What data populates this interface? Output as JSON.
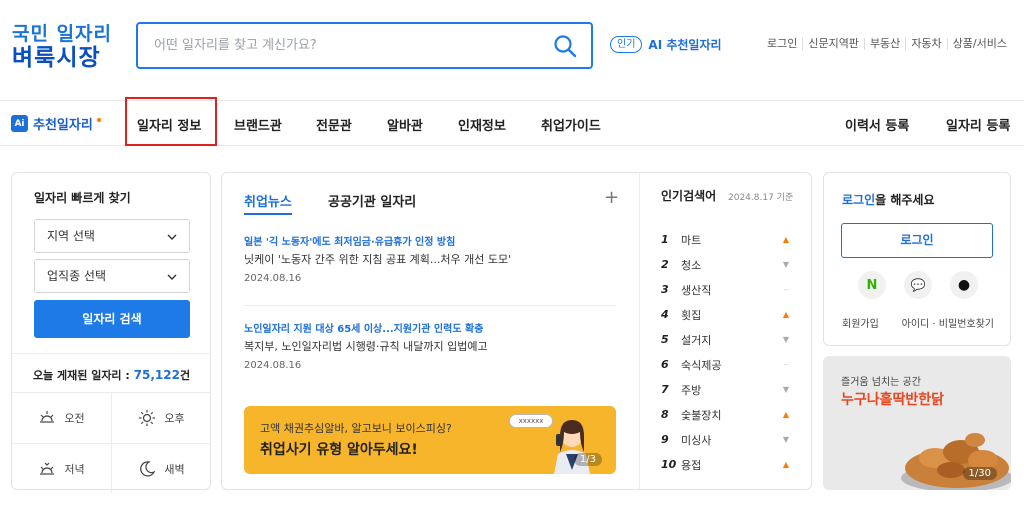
{
  "header": {
    "logo_line1": "국민 일자리",
    "logo_line2": "벼룩시장",
    "search_placeholder": "어떤 일자리를 찾고 계신가요?",
    "ai_badge": "인기",
    "ai_label": "AI 추천일자리",
    "util_links": [
      "로그인",
      "신문지역판",
      "부동산",
      "자동차",
      "상품/서비스"
    ]
  },
  "nav": {
    "ai_icon_text": "Ai",
    "ai_label": "추천일자리",
    "items": [
      "일자리 정보",
      "브랜드관",
      "전문관",
      "알바관",
      "인재정보",
      "취업가이드"
    ],
    "right_items": [
      "이력서 등록",
      "일자리 등록"
    ]
  },
  "quick": {
    "title": "일자리 빠르게 찾기",
    "region": "지역 선택",
    "job_type": "업직종 선택",
    "search_button": "일자리 검색",
    "today_label": "오늘 게재된 일자리 : ",
    "today_count": "75,122",
    "today_unit": "건",
    "times": [
      "오전",
      "오후",
      "저녁",
      "새벽"
    ]
  },
  "news": {
    "tabs": [
      "취업뉴스",
      "공공기관 일자리"
    ],
    "plus": "+",
    "items": [
      {
        "headline": "일본 '긱 노동자'에도 최저임금·유급휴가 인정 방침",
        "summary": "닛케이 '노동자 간주 위한 지침 공표 계획...처우 개선 도모'",
        "date": "2024.08.16"
      },
      {
        "headline": "노인일자리 지원 대상 65세 이상...지원기관 인력도 확충",
        "summary": "복지부, 노인일자리법 시행령·규칙 내달까지 입법예고",
        "date": "2024.08.16"
      }
    ],
    "banner_line1": "고액 채권추심알바, 알고보니 보이스피싱?",
    "banner_line2": "취업사기 유형 알아두세요!",
    "banner_bubble": "xxxxxx",
    "banner_page": "1/3"
  },
  "popular": {
    "title": "인기검색어",
    "date": "2024.8.17 기준",
    "ranks": [
      {
        "n": "1",
        "word": "마트",
        "trend": "up"
      },
      {
        "n": "2",
        "word": "청소",
        "trend": "down"
      },
      {
        "n": "3",
        "word": "생산직",
        "trend": "same"
      },
      {
        "n": "4",
        "word": "횟집",
        "trend": "up"
      },
      {
        "n": "5",
        "word": "설거지",
        "trend": "down"
      },
      {
        "n": "6",
        "word": "숙식제공",
        "trend": "same"
      },
      {
        "n": "7",
        "word": "주방",
        "trend": "down"
      },
      {
        "n": "8",
        "word": "숯불장치",
        "trend": "up"
      },
      {
        "n": "9",
        "word": "미싱사",
        "trend": "down"
      },
      {
        "n": "10",
        "word": "용접",
        "trend": "up"
      }
    ]
  },
  "login": {
    "msg_highlight": "로그인",
    "msg_rest": "을 해주세요",
    "button": "로그인",
    "social": [
      "N",
      "💬",
      "●"
    ],
    "join": "회원가입",
    "find": "아이디 · 비밀번호찾기"
  },
  "promo": {
    "line1": "즐거움 넘치는 공간",
    "line2": "누구나홀딱반한닭",
    "page": "1/30"
  }
}
